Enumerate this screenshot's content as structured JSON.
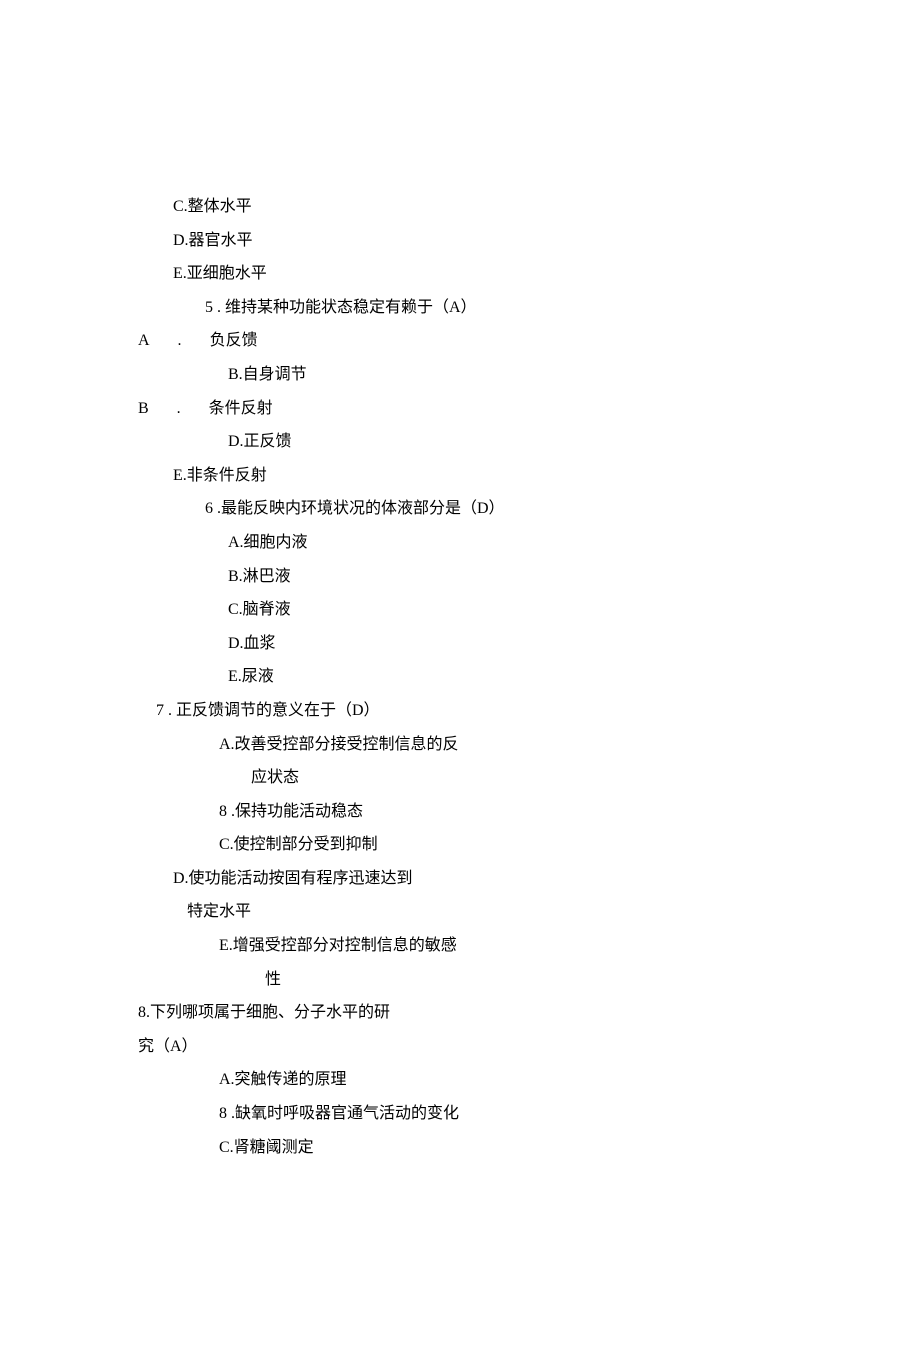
{
  "lines": [
    {
      "cls": "i1",
      "text": "C.整体水平"
    },
    {
      "cls": "i1",
      "text": "D.器官水平"
    },
    {
      "cls": "i1",
      "text": "E.亚细胞水平"
    },
    {
      "cls": "i2",
      "text": "5 . 维持某种功能状态稳定有赖于（A）"
    },
    {
      "cls": "i3",
      "label": "A.",
      "text": "负反馈"
    },
    {
      "cls": "i4",
      "text": "B.自身调节"
    },
    {
      "cls": "i3",
      "label": "B.",
      "text": "条件反射"
    },
    {
      "cls": "i4",
      "text": "D.正反馈"
    },
    {
      "cls": "i1",
      "text": "E.非条件反射"
    },
    {
      "cls": "i2",
      "text": "6 .最能反映内环境状况的体液部分是（D）"
    },
    {
      "cls": "i4",
      "text": "A.细胞内液"
    },
    {
      "cls": "i4",
      "text": "B.淋巴液"
    },
    {
      "cls": "i4",
      "text": "C.脑脊液"
    },
    {
      "cls": "i4",
      "text": "D.血浆"
    },
    {
      "cls": "i4",
      "text": "E.尿液"
    },
    {
      "cls": "i7",
      "text": "7 . 正反馈调节的意义在于（D）"
    },
    {
      "cls": "i5",
      "text": "A.改善受控部分接受控制信息的反"
    },
    {
      "cls": "i6",
      "text": "应状态"
    },
    {
      "cls": "i5",
      "text": "8 .保持功能活动稳态"
    },
    {
      "cls": "i5",
      "text": "C.使控制部分受到抑制"
    },
    {
      "cls": "i1",
      "text": "D.使功能活动按固有程序迅速达到"
    },
    {
      "cls": "i8",
      "text": "特定水平"
    },
    {
      "cls": "i5",
      "text": "E.增强受控部分对控制信息的敏感"
    },
    {
      "cls": "i9",
      "text": "性"
    },
    {
      "cls": "i3",
      "text": "8.下列哪项属于细胞、分子水平的研"
    },
    {
      "cls": "i3",
      "text": "究（A）"
    },
    {
      "cls": "i5",
      "text": "A.突触传递的原理"
    },
    {
      "cls": "i5",
      "text": "8 .缺氧时呼吸器官通气活动的变化"
    },
    {
      "cls": "i5",
      "text": "C.肾糖阈测定"
    }
  ]
}
